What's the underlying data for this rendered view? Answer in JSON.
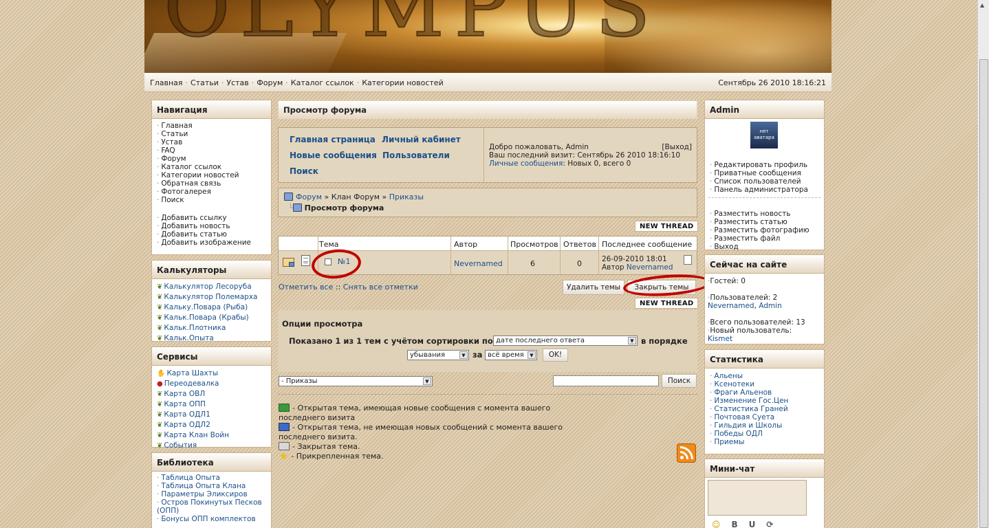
{
  "site": {
    "logo_text": "OLYMPUS",
    "nav": [
      "Главная",
      "Статьи",
      "Устав",
      "Форум",
      "Каталог ссылок",
      "Категории новостей"
    ],
    "nav_separator": "·",
    "datetime": "Сентябрь 26 2010 18:16:21"
  },
  "left": {
    "navigation": {
      "title": "Навигация",
      "items": [
        "Главная",
        "Статьи",
        "Устав",
        "FAQ",
        "Форум",
        "Каталог ссылок",
        "Категории новостей",
        "Обратная связь",
        "Фотогалерея",
        "Поиск"
      ],
      "items2": [
        "Добавить ссылку",
        "Добавить новость",
        "Добавить статью",
        "Добавить изображение"
      ]
    },
    "calculators": {
      "title": "Калькуляторы",
      "items": [
        "Калькулятор Лесоруба",
        "Калькулятор Полемарха",
        "Кальку.Повара (Рыба)",
        "Кальк.Повара (Крабы)",
        "Кальк.Плотника",
        "Кальк.Опыта"
      ]
    },
    "services": {
      "title": "Сервисы",
      "items": [
        "Карта Шахты",
        "Переодевалка",
        "Карта ОВЛ",
        "Карта ОПП",
        "Карта ОДЛ1",
        "Карта ОДЛ2",
        "Карта Клан Войн",
        "События"
      ]
    },
    "library": {
      "title": "Библиотека",
      "items": [
        "Таблица Опыта",
        "Таблица Опыта Клана",
        "Параметры Эликсиров",
        "Остров Покинутых Песков (ОПП)",
        "Бонусы ОПП комплектов"
      ]
    }
  },
  "center": {
    "title": "Просмотр форума",
    "links": {
      "home": "Главная страница",
      "cabinet": "Личный кабинет",
      "new_posts": "Новые сообщения",
      "users": "Пользователи",
      "search": "Поиск"
    },
    "welcome": {
      "greet": "Добро пожаловать, Admin",
      "logout": "[Выход]",
      "last_visit": "Ваш последний визит: Сентябрь 26 2010 18:16:10",
      "pm_link": "Личные сообщения",
      "pm_text": ": Новых 0, всего 0"
    },
    "breadcrumb": {
      "forum": "Форум",
      "sep": "»",
      "clan": "Клан Форум",
      "orders": "Приказы",
      "current": "Просмотр форума"
    },
    "new_thread": "NEW THREAD",
    "table": {
      "headers": [
        "Тема",
        "Автор",
        "Просмотров",
        "Ответов",
        "Последнее сообщение"
      ],
      "row": {
        "topic": "№1",
        "author": "Nevernamed",
        "views": "6",
        "replies": "0",
        "last_date": "26-09-2010 18:01",
        "last_by": "Автор",
        "last_author": "Nevernamed"
      }
    },
    "mark_all": "Отметить все",
    "mark_sep": "::",
    "unmark_all": "Снять все отметки",
    "delete_btn": "Удалить темы",
    "close_btn": "Закрыть темы",
    "options": {
      "title": "Опции просмотра",
      "shown": "Показано 1 из 1 тем с учётом сортировки по",
      "sort_value": "дате последнего ответа",
      "order_label": "в порядке",
      "order_value": "убывания",
      "for_label": "за",
      "period_value": "всё время",
      "ok": "OK!"
    },
    "jump_value": "- Приказы",
    "search_btn": "Поиск",
    "legend": [
      "- Открытая тема, имеющая новые сообщения с момента вашего последнего визита",
      "- Открытая тема, не имеющая новых сообщений с момента вашего последнего визита.",
      "- Закрытая тема.",
      "- Прикрепленная тема."
    ],
    "colors": {
      "open_new": "#3a9a3a",
      "open": "#3a6ad0",
      "closed": "#8a8a8a",
      "sticky": "#e8c020",
      "annotation": "#c00000"
    }
  },
  "right": {
    "user": {
      "title": "Admin",
      "avatar": [
        "нет",
        "аватара"
      ],
      "items": [
        "Редактировать профиль",
        "Приватные сообщения",
        "Список пользователей",
        "Панель администратора"
      ],
      "items2": [
        "Разместить новость",
        "Разместить статью",
        "Разместить фотографию",
        "Разместить файл",
        "Выход"
      ]
    },
    "online": {
      "title": "Сейчас на сайте",
      "guests": "Гостей: 0",
      "users": "Пользователей: 2",
      "user1": "Nevernamed",
      "user2": "Admin",
      "total": "Всего пользователей: 13",
      "newest": "Новый пользователь:",
      "newest_name": "Kismet"
    },
    "stats": {
      "title": "Статистика",
      "items": [
        "Альены",
        "Ксенотеки",
        "Фраги Альенов",
        "Изменение Гос.Цен",
        "Статистика Граней",
        "Почтовая Суета",
        "Гильдия и Школы",
        "Победы ОДЛ",
        "Приемы"
      ]
    },
    "chat": {
      "title": "Мини-чат",
      "tools": [
        "☺",
        "B",
        "U",
        "⟳"
      ]
    }
  }
}
